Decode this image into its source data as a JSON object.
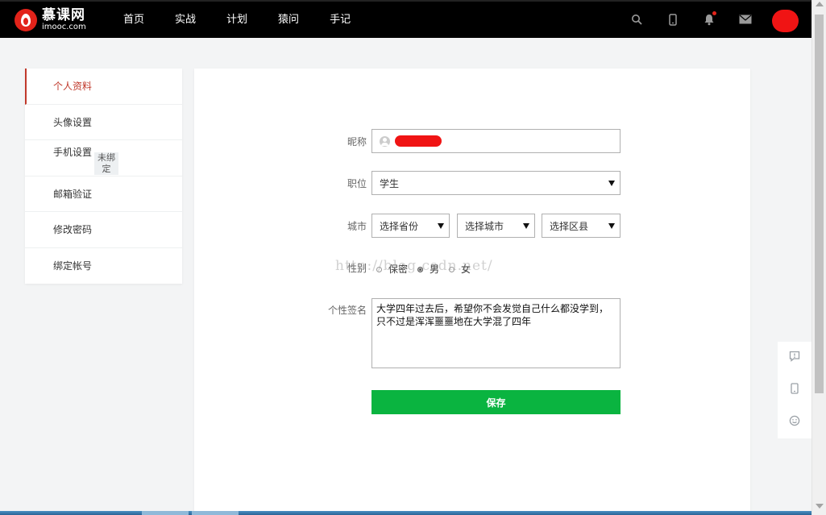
{
  "header": {
    "logo_cn": "慕课网",
    "logo_en": "imooc.com",
    "nav": [
      "首页",
      "实战",
      "计划",
      "猿问",
      "手记"
    ],
    "icons": [
      "search-icon",
      "mobile-icon",
      "bell-icon",
      "mail-icon"
    ],
    "has_notification": true
  },
  "sidebar": {
    "items": [
      {
        "label": "个人资料",
        "active": true
      },
      {
        "label": "头像设置"
      },
      {
        "label": "手机设置",
        "tag": "未绑定"
      },
      {
        "label": "邮箱验证"
      },
      {
        "label": "修改密码"
      },
      {
        "label": "绑定帐号"
      }
    ]
  },
  "form": {
    "nickname_label": "昵称",
    "nickname_value": "",
    "job_label": "职位",
    "job_value": "学生",
    "city_label": "城市",
    "province_value": "选择省份",
    "city_value": "选择城市",
    "district_value": "选择区县",
    "gender_label": "性别",
    "gender_options": [
      "保密",
      "男",
      "女"
    ],
    "gender_selected": "男",
    "signature_label": "个性签名",
    "signature_value": "大学四年过去后，希望你不会发觉自己什么都没学到，只不过是浑浑噩噩地在大学混了四年",
    "save_label": "保存"
  },
  "watermark": "http://blog.csdn.net/",
  "tools": [
    "feedback-icon",
    "app-icon",
    "smile-icon"
  ],
  "colors": {
    "brand": "#e2231a",
    "header_bg": "#000000",
    "save_button": "#0ab440",
    "active_item": "#c0392b"
  }
}
